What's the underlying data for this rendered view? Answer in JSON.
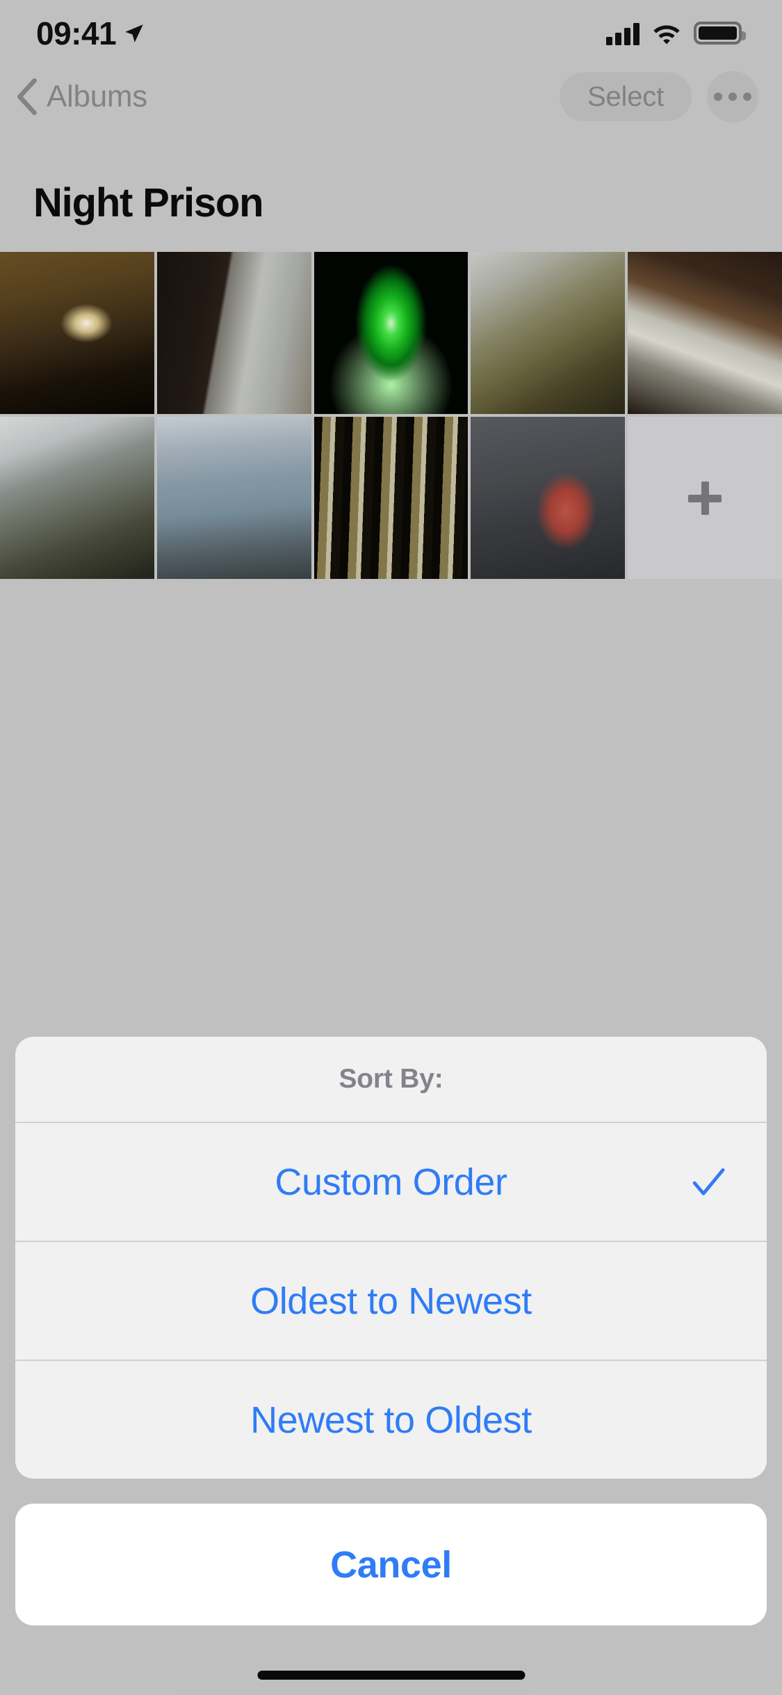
{
  "status_bar": {
    "time": "09:41",
    "location_icon": "location-arrow-icon",
    "signal_icon": "cellular-signal-icon",
    "signal_bars_filled": 4,
    "wifi_icon": "wifi-icon",
    "battery_icon": "battery-full-icon"
  },
  "nav_bar": {
    "back_label": "Albums",
    "back_icon": "chevron-left-icon",
    "select_label": "Select",
    "more_icon": "ellipsis-icon"
  },
  "page_title": "Night Prison",
  "grid": {
    "add_icon": "plus-icon",
    "columns": 5,
    "photos": [
      {
        "name": "lightbulb-in-dark-cell",
        "class": "p1"
      },
      {
        "name": "peeling-wall-with-pillar",
        "class": "p2"
      },
      {
        "name": "green-light-figure",
        "class": "p3"
      },
      {
        "name": "debris-on-floor",
        "class": "p4"
      },
      {
        "name": "old-sink-basin",
        "class": "p5"
      },
      {
        "name": "collapsed-ceiling-rubble",
        "class": "p6"
      },
      {
        "name": "blue-peeling-paint-wall",
        "class": "p7"
      },
      {
        "name": "striped-peeling-corridor",
        "class": "p8"
      },
      {
        "name": "red-prison-chair",
        "class": "p9"
      }
    ]
  },
  "action_sheet": {
    "header": "Sort By:",
    "options": [
      {
        "label": "Custom Order",
        "selected": true,
        "check_icon": "checkmark-icon"
      },
      {
        "label": "Oldest to Newest",
        "selected": false,
        "check_icon": ""
      },
      {
        "label": "Newest to Oldest",
        "selected": false,
        "check_icon": ""
      }
    ],
    "cancel_label": "Cancel"
  },
  "colors": {
    "tint_blue": "#2f7cf6",
    "background": "#cbcbcb",
    "sheet": "#f4f4f4"
  },
  "home_indicator": "home-indicator"
}
